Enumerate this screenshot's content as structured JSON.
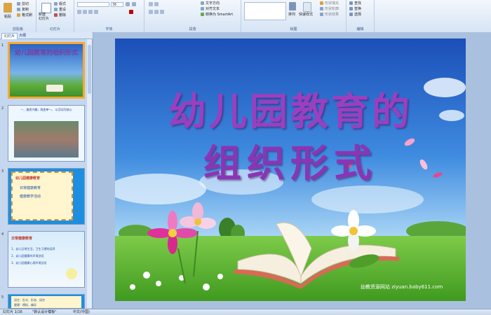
{
  "ribbon": {
    "clipboard": {
      "paste": "粘贴",
      "cut": "剪切",
      "copy": "复制",
      "format_painter": "格式刷",
      "group": "剪贴板"
    },
    "slides": {
      "new_slide": "新建\n幻灯片",
      "layout": "版式",
      "reset": "重设",
      "delete": "删除",
      "group": "幻灯片"
    },
    "font": {
      "size": "36",
      "group": "字体"
    },
    "paragraph": {
      "text_direction": "文字方向",
      "align_text": "对齐文本",
      "smartart": "转换为 SmartArt",
      "group": "段落"
    },
    "drawing": {
      "arrange": "排列",
      "quick_styles": "快速样式",
      "shape_fill": "形状填充",
      "shape_outline": "形状轮廓",
      "shape_effects": "形状效果",
      "group": "绘图"
    },
    "editing": {
      "find": "查找",
      "replace": "替换",
      "select": "选择",
      "group": "编辑"
    }
  },
  "sidebar": {
    "tab_slides": "幻灯片",
    "tab_outline": "大纲",
    "thumbs": [
      {
        "num": "1",
        "title": "幼儿园教育的组织形式"
      },
      {
        "num": "2",
        "title": "一、激发兴趣，改变单一。 以活动为核心"
      },
      {
        "num": "3",
        "title": "幼儿园健康教育",
        "items": [
          "日常健康教育",
          "健康教学活动"
        ]
      },
      {
        "num": "4",
        "title": "日常健康教育",
        "items": [
          "1、幼儿日常生活，卫生习惯的培养",
          "2、幼儿园健康的环境创设",
          "3、幼儿园健康心理环境创设"
        ]
      },
      {
        "num": "5",
        "title": "语言：形式、形态、组合",
        "sub": "健康：模拟，编导"
      }
    ]
  },
  "slide": {
    "title_line1": "幼儿园教育的",
    "title_line2": "组织形式",
    "watermark": "幼教资源网站 ziyuan.baby611.com"
  },
  "status": {
    "slide_count": "幻灯片 1/16",
    "theme": "\"默认设计模板\"",
    "language": "中文(中国)"
  }
}
